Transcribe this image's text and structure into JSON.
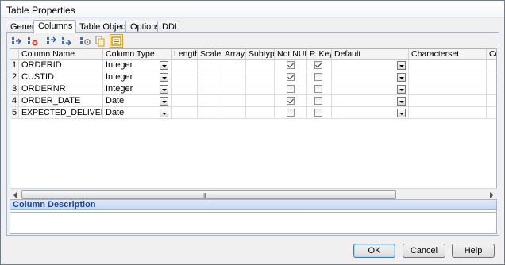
{
  "window": {
    "title": "Table Properties"
  },
  "tabs": [
    {
      "label": "General",
      "active": false
    },
    {
      "label": "Columns",
      "active": true
    },
    {
      "label": "Table Objects",
      "active": false
    },
    {
      "label": "Options",
      "active": false
    },
    {
      "label": "DDL",
      "active": false
    }
  ],
  "toolbar": {
    "buttons": [
      {
        "icon": "insert-column-icon"
      },
      {
        "icon": "delete-column-icon"
      },
      {
        "icon": "move-up-icon"
      },
      {
        "icon": "move-down-icon"
      },
      {
        "icon": "properties-icon"
      },
      {
        "icon": "copy-icon"
      },
      {
        "icon": "toggle-view-icon",
        "pressed": true
      }
    ]
  },
  "grid": {
    "headers": {
      "column_name": "Column Name",
      "column_type": "Column Type",
      "length": "Length",
      "scale": "Scale",
      "array": "Array",
      "subtype": "Subtype",
      "not_null": "Not NULL",
      "p_key": "P. Key",
      "default": "Default",
      "characterset": "Characterset",
      "collate": "Colla"
    },
    "rows": [
      {
        "num": "1",
        "name": "ORDERID",
        "type": "Integer",
        "not_null": true,
        "p_key": true
      },
      {
        "num": "2",
        "name": "CUSTID",
        "type": "Integer",
        "not_null": true,
        "p_key": false
      },
      {
        "num": "3",
        "name": "ORDERNR",
        "type": "Integer",
        "not_null": false,
        "p_key": false
      },
      {
        "num": "4",
        "name": "ORDER_DATE",
        "type": "Date",
        "not_null": true,
        "p_key": false
      },
      {
        "num": "5",
        "name": "EXPECTED_DELIVERY_DATE",
        "type": "Date",
        "not_null": false,
        "p_key": false
      }
    ],
    "scroll_grip": "III"
  },
  "description": {
    "label": "Column Description",
    "value": ""
  },
  "buttons": {
    "ok": "OK",
    "cancel": "Cancel",
    "help": "Help"
  },
  "colors": {
    "accent": "#1c46a0",
    "desc_header_bg": "#c6d8f1",
    "pressed_btn": "#fde9a6"
  }
}
